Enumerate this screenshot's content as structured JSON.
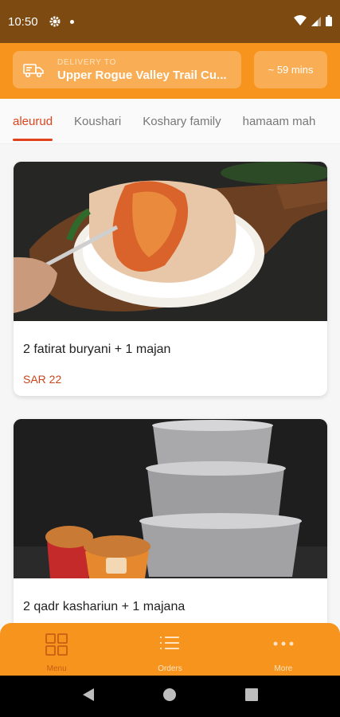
{
  "status_bar": {
    "time": "10:50"
  },
  "header": {
    "delivery_label": "DELIVERY TO",
    "delivery_address": "Upper Rogue Valley Trail Cu...",
    "eta": "~ 59 mins"
  },
  "tabs": [
    {
      "label": "aleurud",
      "active": true
    },
    {
      "label": "Koushari",
      "active": false
    },
    {
      "label": "Koshary family",
      "active": false
    },
    {
      "label": "hamaam mah",
      "active": false
    }
  ],
  "items": [
    {
      "title": "2 fatirat buryani + 1 majan",
      "price": "SAR 22"
    },
    {
      "title": "2 qadr kashariun + 1 majana",
      "price": ""
    }
  ],
  "bottom_nav": [
    {
      "label": "Menu",
      "icon": "grid-icon",
      "active": true
    },
    {
      "label": "Orders",
      "icon": "list-icon",
      "active": false
    },
    {
      "label": "More",
      "icon": "more-dots-icon",
      "active": false
    }
  ],
  "colors": {
    "primary": "#f7941d",
    "status_bar": "#7d4a12",
    "accent": "#e0431c"
  }
}
